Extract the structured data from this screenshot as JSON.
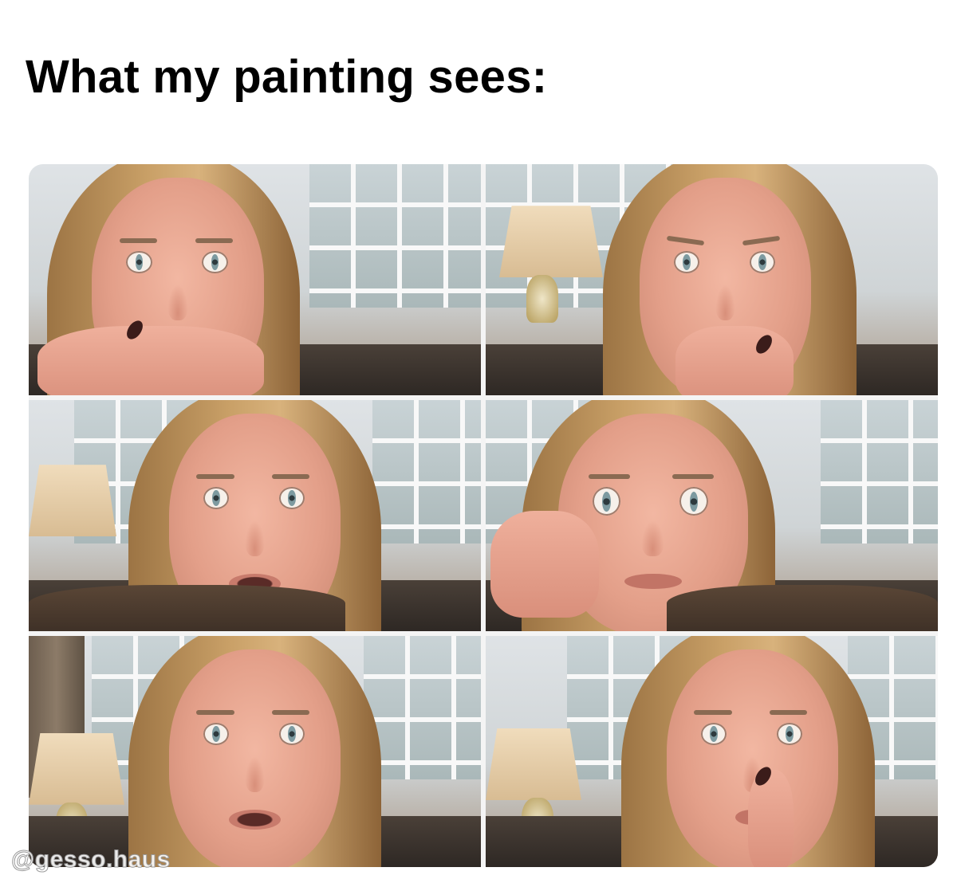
{
  "meme": {
    "caption": "What my painting sees:",
    "watermark": "@gesso.haus"
  },
  "collage": {
    "layout": "3 rows x 2 columns",
    "panel_count": 6
  },
  "colors": {
    "background": "#ffffff",
    "caption_text": "#000000"
  }
}
